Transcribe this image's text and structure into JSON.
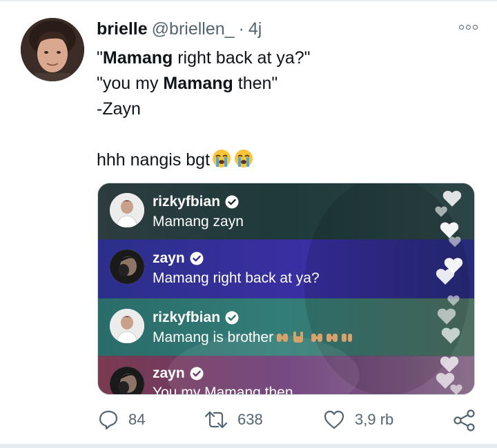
{
  "tweet": {
    "author_name": "brielle",
    "author_handle": "@briellen_",
    "separator": "·",
    "time": "4j",
    "text": {
      "l1_open": "\"",
      "l1_bold": "Mamang",
      "l1_rest": " right back at ya?\"",
      "l2_pre": "\"you my ",
      "l2_bold": "Mamang",
      "l2_post": " then\"",
      "l3": "-Zayn",
      "l4": "hhh nangis bgt"
    },
    "emoji": [
      "crying-face",
      "crying-face"
    ]
  },
  "media": {
    "comments": [
      {
        "user": "rizkyfbian",
        "text": "Mamang zayn"
      },
      {
        "user": "zayn",
        "text": "Mamang right back at ya?"
      },
      {
        "user": "rizkyfbian",
        "text": "Mamang is brother"
      },
      {
        "user": "zayn",
        "text": "You my Mamang then"
      }
    ]
  },
  "actions": {
    "replies": "84",
    "retweets": "638",
    "likes": "3,9 rb"
  },
  "colors": {
    "muted": "#536471",
    "text": "#0f1419",
    "row_blue": "#2f2a8f",
    "row_teal": "#2b6f6f",
    "row_purple": "#6a3a6e"
  }
}
